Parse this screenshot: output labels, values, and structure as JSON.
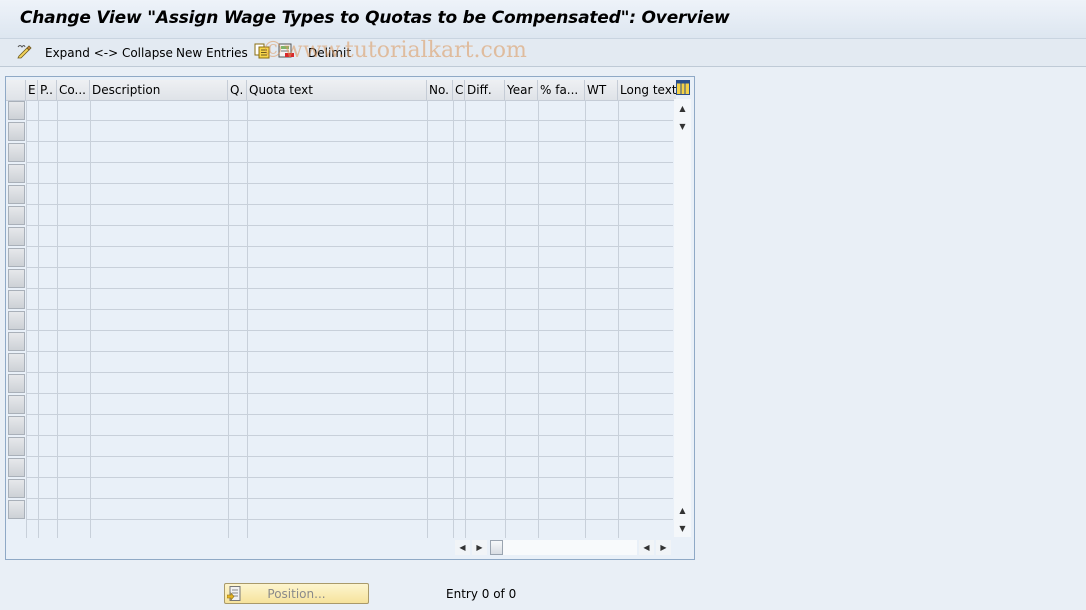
{
  "window": {
    "title": "Change View \"Assign Wage Types to Quotas to be Compensated\": Overview"
  },
  "toolbar": {
    "items": [
      {
        "icon": "display-change-icon"
      },
      {
        "label": "Expand <-> Collapse"
      },
      {
        "label": "New Entries"
      },
      {
        "icon": "copy-as-icon"
      },
      {
        "icon": "delete-icon"
      },
      {
        "label": "Delimit"
      }
    ],
    "expand_collapse_label": "Expand <-> Collapse",
    "new_entries_label": "New Entries",
    "delimit_label": "Delimit"
  },
  "watermark": "©www.tutorialkart.com",
  "table": {
    "columns": [
      {
        "key": "e",
        "label": "E"
      },
      {
        "key": "p",
        "label": "P.."
      },
      {
        "key": "co",
        "label": "Co..."
      },
      {
        "key": "description",
        "label": "Description"
      },
      {
        "key": "q",
        "label": "Q."
      },
      {
        "key": "quota_text",
        "label": "Quota text"
      },
      {
        "key": "no",
        "label": "No."
      },
      {
        "key": "c",
        "label": "C"
      },
      {
        "key": "diff",
        "label": "Diff."
      },
      {
        "key": "year",
        "label": "Year"
      },
      {
        "key": "pct",
        "label": "% fa..."
      },
      {
        "key": "wt",
        "label": "WT"
      },
      {
        "key": "long_text",
        "label": "Long text"
      }
    ],
    "rows": [],
    "visible_empty_rows": 20
  },
  "footer": {
    "position_button_label": "Position...",
    "entry_text": "Entry 0 of 0"
  }
}
